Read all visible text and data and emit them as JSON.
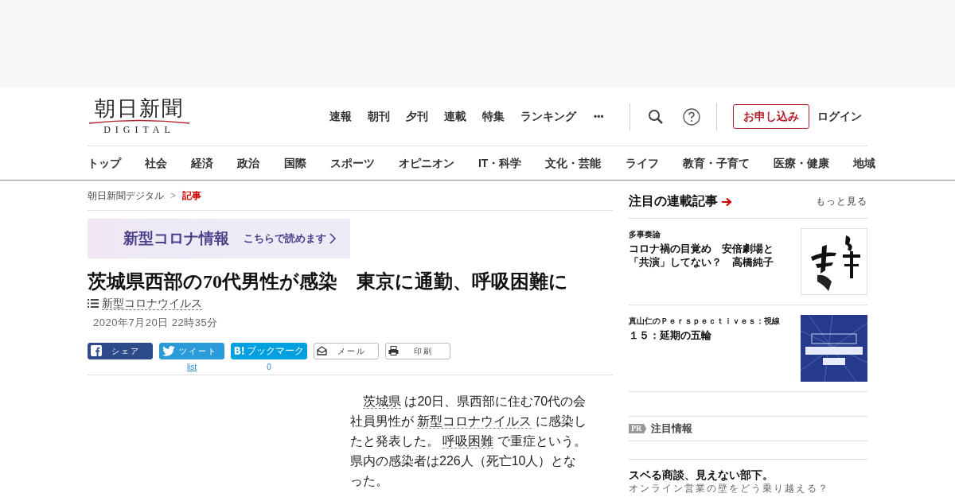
{
  "logo": {
    "title": "朝日新聞",
    "subtitle": "DIGITAL"
  },
  "top_nav": [
    "速報",
    "朝刊",
    "夕刊",
    "連載",
    "特集",
    "ランキング"
  ],
  "header_actions": {
    "more": "•••",
    "subscribe": "お申し込み",
    "login": "ログイン"
  },
  "categories": [
    "トップ",
    "社会",
    "経済",
    "政治",
    "国際",
    "スポーツ",
    "オピニオン",
    "IT・科学",
    "文化・芸能",
    "ライフ",
    "教育・子育て",
    "医療・健康",
    "地域"
  ],
  "breadcrumb_separator": ">",
  "breadcrumb": [
    {
      "label": "朝日新聞デジタル",
      "selected": false
    },
    {
      "label": "記事",
      "selected": true
    }
  ],
  "banner": {
    "title": "新型コロナ情報",
    "link": "こちらで読めます"
  },
  "article": {
    "title": "茨城県西部の70代男性が感染　東京に通勤、呼吸困難に",
    "topic": "新型コロナウイルス",
    "date": "2020年7月20日 22時35分",
    "share": [
      {
        "kind": "facebook",
        "label": "シェア"
      },
      {
        "kind": "twitter",
        "label": "ツイート",
        "count": "list"
      },
      {
        "kind": "hatena",
        "label": "ブックマーク",
        "count": "0"
      },
      {
        "kind": "mail",
        "label": "メール"
      },
      {
        "kind": "print",
        "label": "印刷"
      }
    ],
    "body": [
      {
        "text": "茨城県",
        "link": true
      },
      {
        "text": " は20日、県西部に住む70代の会社員男性が "
      },
      {
        "text": "新型コロナウイルス",
        "link": true
      },
      {
        "text": " に感染したと発表した。 "
      },
      {
        "text": "呼吸困難",
        "link": true
      },
      {
        "text": " で重症という。県内の感染者は226人（死亡10人）となった。"
      }
    ]
  },
  "sidebar": {
    "title": "注目の連載記事",
    "more": "もっと見る",
    "items": [
      {
        "series": "多事奏論",
        "headline": "コロナ禍の目覚め　安倍劇場と「共演」してない？　高橋純子"
      },
      {
        "series": "真山仁のＰｅｒｓｐｅｃｔｉｖｅｓ：視線",
        "headline": "１５：延期の五輪"
      }
    ],
    "pr": {
      "badge": "PR",
      "title": "注目情報"
    },
    "promo": {
      "title": "スベる商談、見えない部下。",
      "subtitle": "オンライン営業の壁をどう乗り越える？"
    }
  }
}
